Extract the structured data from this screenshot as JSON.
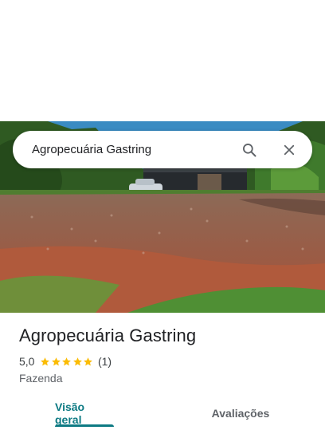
{
  "search": {
    "query": "Agropecuária Gastring"
  },
  "place": {
    "name": "Agropecuária Gastring",
    "rating_value": "5,0",
    "stars": 5,
    "review_count": "(1)",
    "category": "Fazenda"
  },
  "tabs": [
    {
      "label": "Visão geral",
      "selected": true
    },
    {
      "label": "Avaliações",
      "selected": false
    }
  ],
  "colors": {
    "accent": "#0d7a83",
    "star": "#fbbc04"
  },
  "icons": {
    "search": "search-icon",
    "close": "close-icon",
    "star": "star-icon"
  }
}
